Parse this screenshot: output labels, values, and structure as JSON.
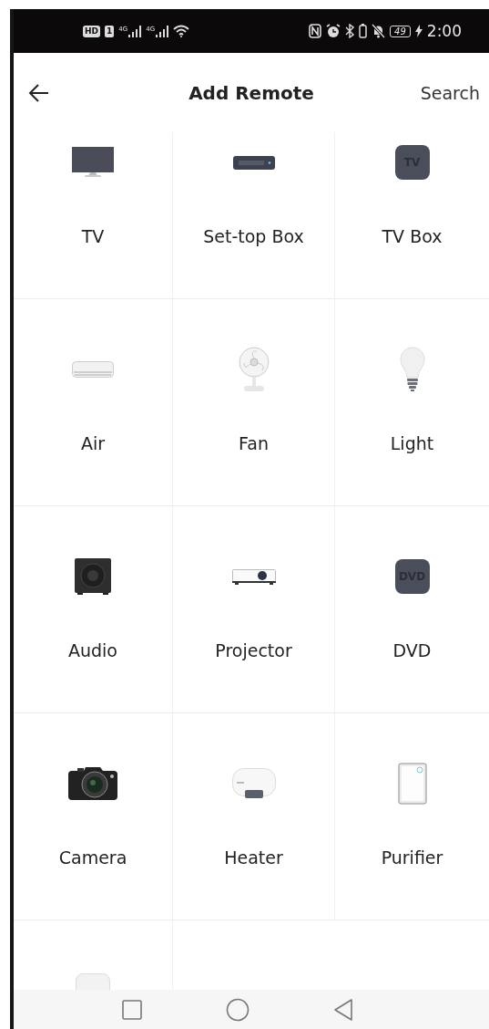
{
  "status_bar": {
    "hd_badge": "HD",
    "sim_badge": "1",
    "networks": [
      "4G",
      "4G"
    ],
    "battery": "49",
    "time": "2:00"
  },
  "header": {
    "title": "Add Remote",
    "action": "Search"
  },
  "devices": [
    {
      "kind": "tv",
      "label": "TV"
    },
    {
      "kind": "set_top_box",
      "label": "Set-top Box"
    },
    {
      "kind": "tv_box",
      "label": "TV Box",
      "icon_text": "TV"
    },
    {
      "kind": "air",
      "label": "Air"
    },
    {
      "kind": "fan",
      "label": "Fan"
    },
    {
      "kind": "light",
      "label": "Light"
    },
    {
      "kind": "audio",
      "label": "Audio"
    },
    {
      "kind": "projector",
      "label": "Projector"
    },
    {
      "kind": "dvd",
      "label": "DVD",
      "icon_text": "DVD"
    },
    {
      "kind": "camera",
      "label": "Camera"
    },
    {
      "kind": "heater",
      "label": "Heater"
    },
    {
      "kind": "purifier",
      "label": "Purifier"
    },
    {
      "kind": "diy"
    }
  ]
}
